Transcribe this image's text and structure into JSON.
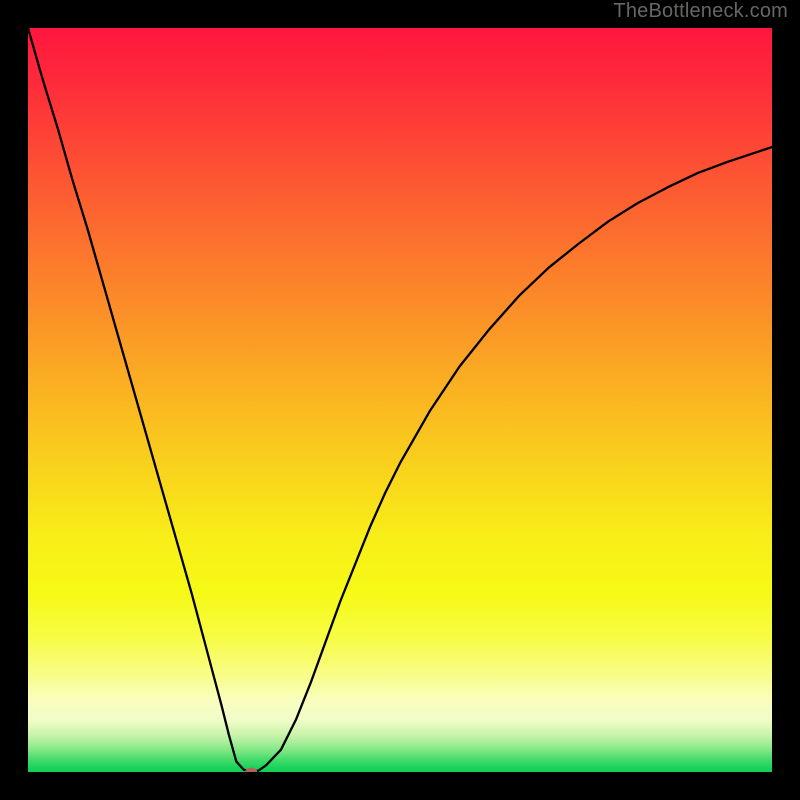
{
  "watermark": "TheBottleneck.com",
  "chart_data": {
    "type": "line",
    "title": "",
    "xlabel": "",
    "ylabel": "",
    "xlim": [
      0,
      100
    ],
    "ylim": [
      0,
      100
    ],
    "x": [
      0,
      2,
      4,
      6,
      8,
      10,
      12,
      14,
      16,
      18,
      20,
      22,
      24,
      26,
      27,
      28,
      29,
      30,
      31,
      32,
      34,
      36,
      38,
      40,
      42,
      44,
      46,
      48,
      50,
      54,
      58,
      62,
      66,
      70,
      74,
      78,
      82,
      86,
      90,
      94,
      100
    ],
    "values": [
      100,
      93,
      86.5,
      79.5,
      73,
      66,
      59,
      52,
      45,
      38,
      31,
      24,
      16.5,
      9,
      5,
      1.4,
      0.3,
      0,
      0.2,
      0.9,
      3,
      7,
      12,
      17.5,
      23,
      28,
      33,
      37.5,
      41.5,
      48.5,
      54.5,
      59.5,
      64,
      67.8,
      71,
      74,
      76.5,
      78.6,
      80.5,
      82,
      84
    ],
    "marker": {
      "x": 30,
      "y": 0,
      "color": "#b66158"
    },
    "gradient_stops": [
      {
        "offset": 0.0,
        "color": "#fe163e"
      },
      {
        "offset": 0.08,
        "color": "#fe2d3a"
      },
      {
        "offset": 0.18,
        "color": "#fd4e34"
      },
      {
        "offset": 0.28,
        "color": "#fc6f2e"
      },
      {
        "offset": 0.38,
        "color": "#fb8f28"
      },
      {
        "offset": 0.48,
        "color": "#fab022"
      },
      {
        "offset": 0.58,
        "color": "#f9cf1d"
      },
      {
        "offset": 0.68,
        "color": "#f8ed18"
      },
      {
        "offset": 0.76,
        "color": "#f6fa16"
      },
      {
        "offset": 0.82,
        "color": "#f7fc45"
      },
      {
        "offset": 0.87,
        "color": "#f8fd8a"
      },
      {
        "offset": 0.905,
        "color": "#f9fec0"
      },
      {
        "offset": 0.93,
        "color": "#f1fcc7"
      },
      {
        "offset": 0.95,
        "color": "#c9f4ab"
      },
      {
        "offset": 0.968,
        "color": "#8de98a"
      },
      {
        "offset": 0.982,
        "color": "#4adc6d"
      },
      {
        "offset": 0.995,
        "color": "#16d25a"
      },
      {
        "offset": 1.0,
        "color": "#0fd058"
      }
    ]
  }
}
